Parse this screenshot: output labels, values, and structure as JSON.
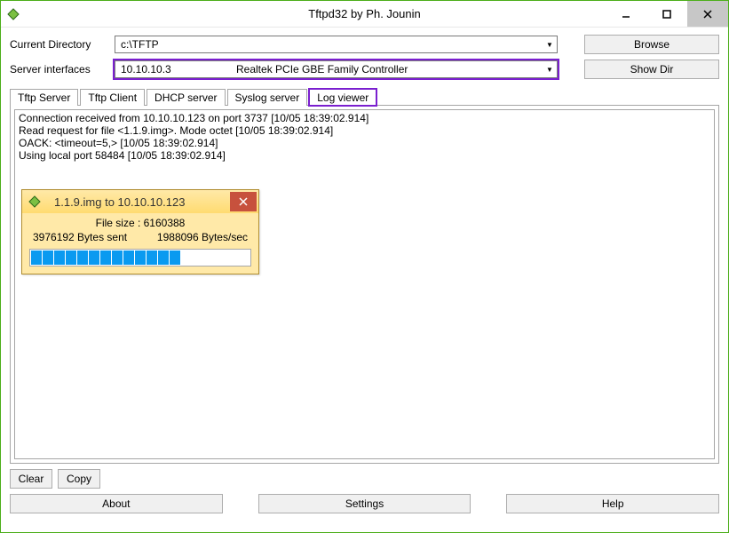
{
  "window": {
    "title": "Tftpd32 by Ph. Jounin"
  },
  "form": {
    "current_dir_label": "Current Directory",
    "current_dir_value": "c:\\TFTP",
    "server_if_label": "Server interfaces",
    "server_if_ip": "10.10.10.3",
    "server_if_desc": "Realtek PCIe GBE Family Controller",
    "browse_label": "Browse",
    "showdir_label": "Show Dir"
  },
  "tabs": [
    "Tftp Server",
    "Tftp Client",
    "DHCP server",
    "Syslog server",
    "Log viewer"
  ],
  "active_tab": 4,
  "log_lines": [
    "Connection received from 10.10.10.123 on port 3737 [10/05 18:39:02.914]",
    "Read request for file <1.1.9.img>. Mode octet [10/05 18:39:02.914]",
    "OACK: <timeout=5,> [10/05 18:39:02.914]",
    "Using local port 58484 [10/05 18:39:02.914]"
  ],
  "transfer": {
    "title": "1.1.9.img to 10.10.10.123",
    "filesize_label": "File size : 6160388",
    "bytes_sent": "3976192 Bytes sent",
    "rate": "1988096 Bytes/sec",
    "segments_total": 20,
    "segments_filled": 13
  },
  "buttons": {
    "clear": "Clear",
    "copy": "Copy",
    "about": "About",
    "settings": "Settings",
    "help": "Help"
  }
}
